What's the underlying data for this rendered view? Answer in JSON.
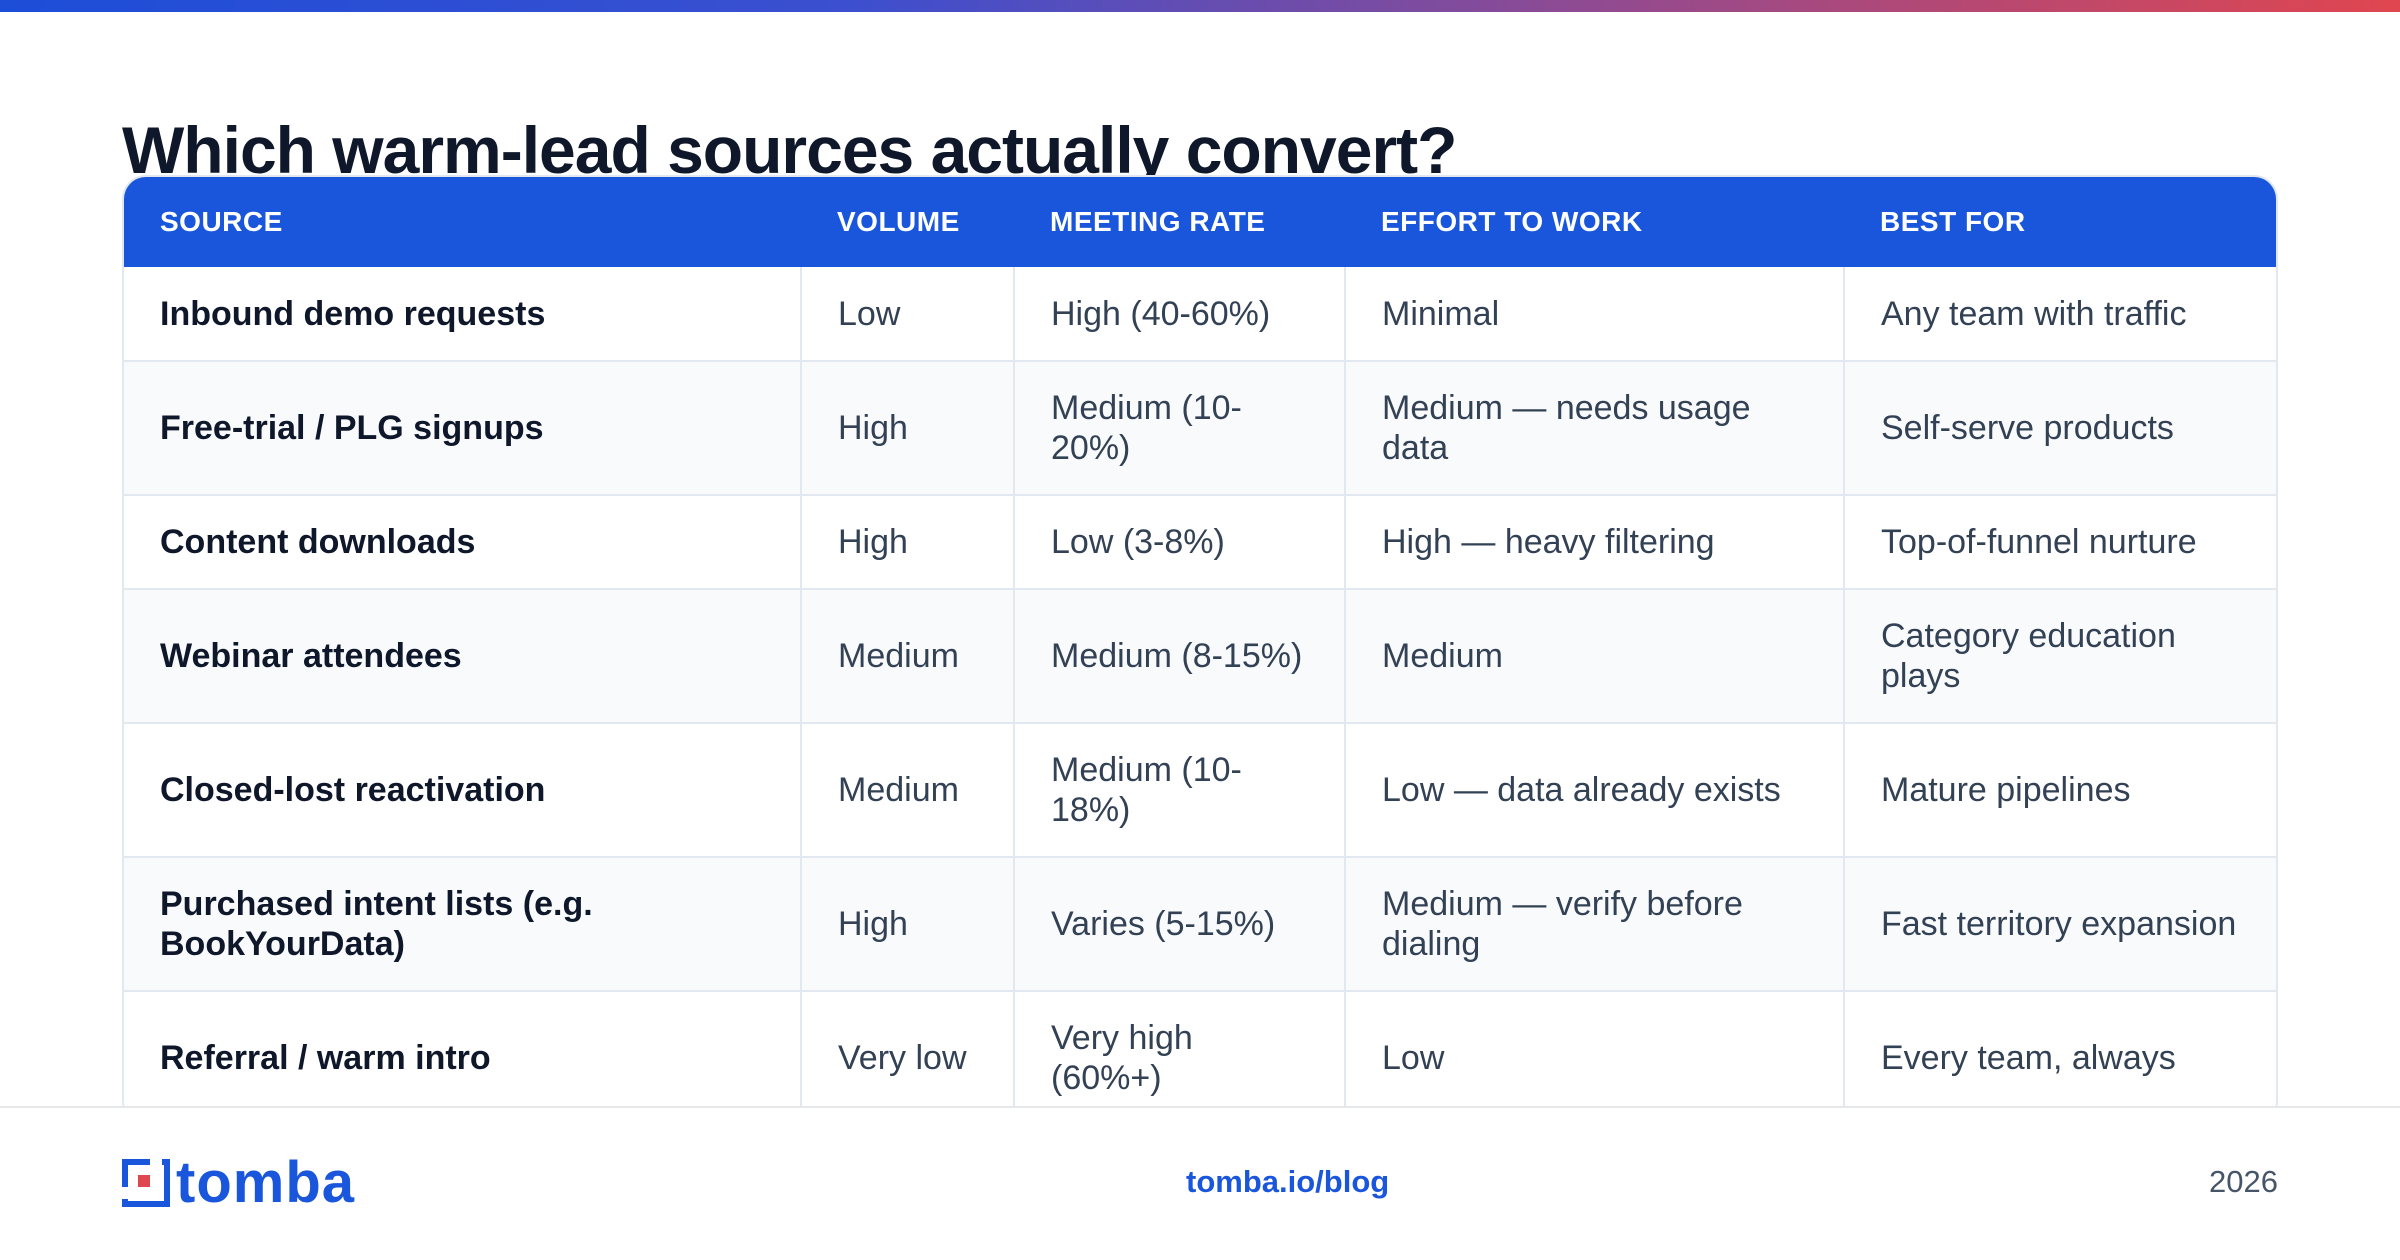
{
  "title": "Which warm-lead sources actually convert?",
  "table": {
    "headers": [
      "SOURCE",
      "VOLUME",
      "MEETING RATE",
      "EFFORT TO WORK",
      "BEST FOR"
    ],
    "rows": [
      {
        "source": "Inbound demo requests",
        "volume": "Low",
        "meeting_rate": "High (40-60%)",
        "effort": "Minimal",
        "best_for": "Any team with traffic"
      },
      {
        "source": "Free-trial / PLG signups",
        "volume": "High",
        "meeting_rate": "Medium (10-20%)",
        "effort": "Medium — needs usage data",
        "best_for": "Self-serve products"
      },
      {
        "source": "Content downloads",
        "volume": "High",
        "meeting_rate": "Low (3-8%)",
        "effort": "High — heavy filtering",
        "best_for": "Top-of-funnel nurture"
      },
      {
        "source": "Webinar attendees",
        "volume": "Medium",
        "meeting_rate": "Medium (8-15%)",
        "effort": "Medium",
        "best_for": "Category education plays"
      },
      {
        "source": "Closed-lost reactivation",
        "volume": "Medium",
        "meeting_rate": "Medium (10-18%)",
        "effort": "Low — data already exists",
        "best_for": "Mature pipelines"
      },
      {
        "source": "Purchased intent lists (e.g. BookYourData)",
        "volume": "High",
        "meeting_rate": "Varies (5-15%)",
        "effort": "Medium — verify before dialing",
        "best_for": "Fast territory expansion"
      },
      {
        "source": "Referral / warm intro",
        "volume": "Very low",
        "meeting_rate": "Very high (60%+)",
        "effort": "Low",
        "best_for": "Every team, always"
      }
    ]
  },
  "footer": {
    "logo_text": "tomba",
    "link": "tomba.io/blog",
    "year": "2026"
  },
  "colors": {
    "brand_blue": "#1a56db",
    "gradient_start": "#1d4ed8",
    "gradient_end": "#e0464f"
  }
}
